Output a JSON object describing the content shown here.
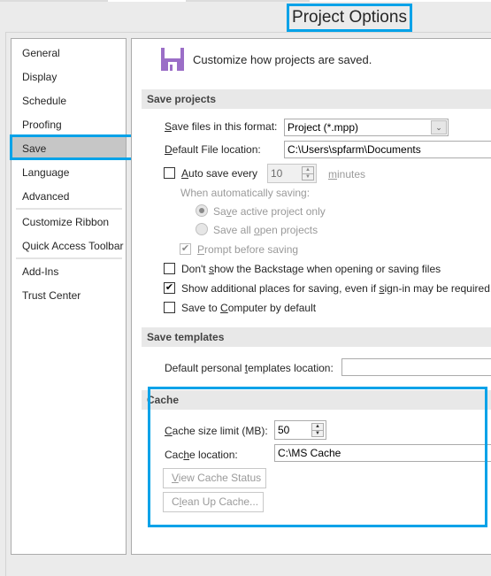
{
  "window": {
    "title": "Project Options"
  },
  "sidebar": {
    "items": [
      {
        "label": "General",
        "selected": false
      },
      {
        "label": "Display",
        "selected": false
      },
      {
        "label": "Schedule",
        "selected": false
      },
      {
        "label": "Proofing",
        "selected": false
      },
      {
        "label": "Save",
        "selected": true
      },
      {
        "label": "Language",
        "selected": false
      },
      {
        "label": "Advanced",
        "selected": false
      },
      {
        "label": "Customize Ribbon",
        "selected": false
      },
      {
        "label": "Quick Access Toolbar",
        "selected": false
      },
      {
        "label": "Add-Ins",
        "selected": false
      },
      {
        "label": "Trust Center",
        "selected": false
      }
    ]
  },
  "main": {
    "header_icon": "save-floppy-icon",
    "header_text": "Customize how projects are saved.",
    "save_projects": {
      "title": "Save projects",
      "format_label_u": "S",
      "format_label_rest": "ave files in this format:",
      "format_value": "Project (*.mpp)",
      "location_label_u": "D",
      "location_label_rest": "efault File location:",
      "location_value": "C:\\Users\\spfarm\\Documents",
      "autosave_checked": false,
      "autosave_label_u": "A",
      "autosave_label_rest": "uto save every",
      "autosave_value": "10",
      "minutes_u": "m",
      "minutes_rest": "inutes",
      "when_label": "When automatically saving:",
      "radio_active_pre": "Sa",
      "radio_active_u": "v",
      "radio_active_post": "e active project only",
      "radio_active_selected": true,
      "radio_all_pre": "Save all ",
      "radio_all_u": "o",
      "radio_all_post": "pen projects",
      "radio_all_selected": false,
      "prompt_checked": true,
      "prompt_u": "P",
      "prompt_rest": "rompt before saving",
      "backstage_checked": false,
      "backstage_pre": "Don't ",
      "backstage_u": "s",
      "backstage_post": "how the Backstage when opening or saving files",
      "additional_checked": true,
      "additional_pre": "Show additional places for saving, even if ",
      "additional_u": "s",
      "additional_post": "ign-in may be required.",
      "computer_checked": false,
      "computer_pre": "Save to ",
      "computer_u": "C",
      "computer_post": "omputer by default"
    },
    "save_templates": {
      "title": "Save templates",
      "label_pre": "Default personal ",
      "label_u": "t",
      "label_post": "emplates location:",
      "value": ""
    },
    "cache": {
      "title": "Cache",
      "size_u": "C",
      "size_rest": "ache size limit (MB):",
      "size_value": "50",
      "location_pre": "Cac",
      "location_u": "h",
      "location_post": "e location:",
      "location_value": "C:\\MS Cache",
      "view_btn_u": "V",
      "view_btn_rest": "iew Cache Status",
      "cleanup_btn_pre": "C",
      "cleanup_btn_u": "l",
      "cleanup_btn_post": "ean Up Cache..."
    }
  },
  "colors": {
    "highlight": "#00a2e8",
    "save_icon": "#9b6ec7",
    "selected_nav": "#c6c6c6"
  }
}
